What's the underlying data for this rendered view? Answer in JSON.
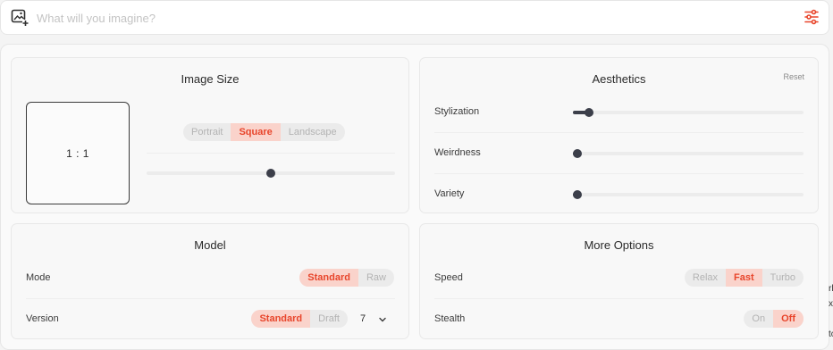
{
  "prompt": {
    "placeholder": "What will you imagine?",
    "value": "",
    "image_icon": "image-add-icon",
    "settings_icon": "sliders-icon",
    "accent_color": "#e8452b"
  },
  "image_size": {
    "title": "Image Size",
    "ratio_label": "1 : 1",
    "orientation_options": [
      "Portrait",
      "Square",
      "Landscape"
    ],
    "orientation_selected": "Square",
    "slider_fraction": 0.5
  },
  "aesthetics": {
    "title": "Aesthetics",
    "reset_label": "Reset",
    "sliders": [
      {
        "label": "Stylization",
        "fraction": 0.05
      },
      {
        "label": "Weirdness",
        "fraction": 0.0
      },
      {
        "label": "Variety",
        "fraction": 0.0
      }
    ]
  },
  "model": {
    "title": "Model",
    "mode_label": "Mode",
    "mode_options": [
      "Standard",
      "Raw"
    ],
    "mode_selected": "Standard",
    "version_label": "Version",
    "version_options": [
      "Standard",
      "Draft"
    ],
    "version_selected": "Standard",
    "version_value": "7",
    "dropdown_icon": "chevron-down-icon"
  },
  "more_options": {
    "title": "More Options",
    "speed_label": "Speed",
    "speed_options": [
      "Relax",
      "Fast",
      "Turbo"
    ],
    "speed_selected": "Fast",
    "stealth_label": "Stealth",
    "stealth_options": [
      "On",
      "Off"
    ],
    "stealth_selected": "Off"
  },
  "edge_fragments": [
    "rl",
    "x",
    "to"
  ]
}
